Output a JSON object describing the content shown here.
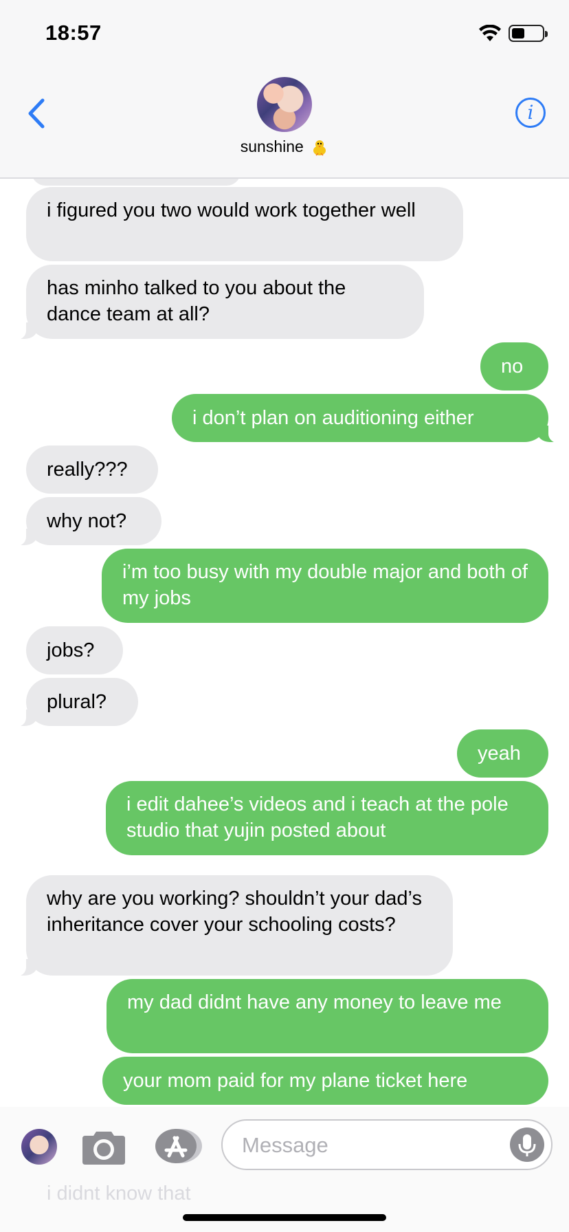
{
  "status_bar": {
    "time": "18:57",
    "battery_level": 0.4
  },
  "header": {
    "contact_name": "sunshine",
    "contact_emoji": "🐥"
  },
  "messages": [
    {
      "side": "in",
      "text": "i figured you two would work together well"
    },
    {
      "side": "in",
      "text": "has minho talked to you about the dance team at all?"
    },
    {
      "side": "out",
      "text": "no"
    },
    {
      "side": "out",
      "text": "i don’t plan on auditioning either"
    },
    {
      "side": "in",
      "text": "really???"
    },
    {
      "side": "in",
      "text": "why not?"
    },
    {
      "side": "out",
      "text": "i’m too busy with my double major and both of my jobs"
    },
    {
      "side": "in",
      "text": "jobs?"
    },
    {
      "side": "in",
      "text": "plural?"
    },
    {
      "side": "out",
      "text": "yeah"
    },
    {
      "side": "out",
      "text": "i edit dahee’s videos and i teach at the pole studio that yujin posted about"
    },
    {
      "side": "in",
      "text": "why are you working? shouldn’t your dad’s inheritance cover your schooling costs?"
    },
    {
      "side": "out",
      "text": "my dad didnt have any money to leave me"
    },
    {
      "side": "out",
      "text": "your mom paid for my plane ticket here"
    }
  ],
  "hidden_under_bar": {
    "text": "i didnt know that"
  },
  "input": {
    "placeholder": "Message"
  },
  "colors": {
    "incoming": "#e9e9eb",
    "outgoing": "#67c665",
    "accent": "#2e7cf6"
  },
  "icons": [
    "back-chevron-icon",
    "info-icon",
    "camera-icon",
    "app-store-icon",
    "microphone-icon",
    "wifi-icon",
    "battery-icon"
  ]
}
